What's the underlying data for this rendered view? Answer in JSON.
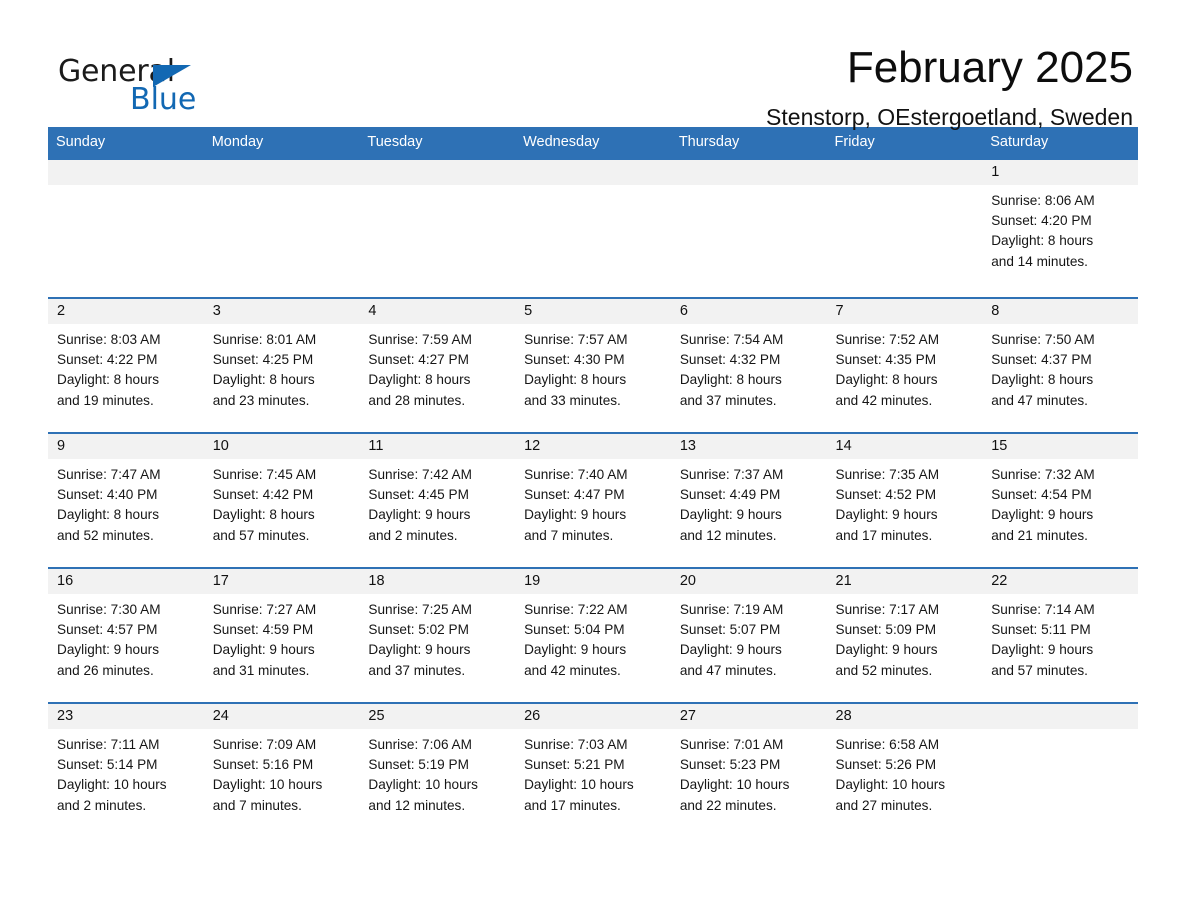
{
  "brand": {
    "name_part1": "General",
    "name_part2": "Blue",
    "accent_color": "#1268b3"
  },
  "header": {
    "month_title": "February 2025",
    "location": "Stenstorp, OEstergoetland, Sweden"
  },
  "theme": {
    "header_blue": "#2E71B5",
    "daynum_band": "#f2f2f2"
  },
  "weekdays": [
    "Sunday",
    "Monday",
    "Tuesday",
    "Wednesday",
    "Thursday",
    "Friday",
    "Saturday"
  ],
  "weeks": [
    [
      {
        "day": "",
        "info": ""
      },
      {
        "day": "",
        "info": ""
      },
      {
        "day": "",
        "info": ""
      },
      {
        "day": "",
        "info": ""
      },
      {
        "day": "",
        "info": ""
      },
      {
        "day": "",
        "info": ""
      },
      {
        "day": "1",
        "info": "Sunrise: 8:06 AM\nSunset: 4:20 PM\nDaylight: 8 hours\nand 14 minutes."
      }
    ],
    [
      {
        "day": "2",
        "info": "Sunrise: 8:03 AM\nSunset: 4:22 PM\nDaylight: 8 hours\nand 19 minutes."
      },
      {
        "day": "3",
        "info": "Sunrise: 8:01 AM\nSunset: 4:25 PM\nDaylight: 8 hours\nand 23 minutes."
      },
      {
        "day": "4",
        "info": "Sunrise: 7:59 AM\nSunset: 4:27 PM\nDaylight: 8 hours\nand 28 minutes."
      },
      {
        "day": "5",
        "info": "Sunrise: 7:57 AM\nSunset: 4:30 PM\nDaylight: 8 hours\nand 33 minutes."
      },
      {
        "day": "6",
        "info": "Sunrise: 7:54 AM\nSunset: 4:32 PM\nDaylight: 8 hours\nand 37 minutes."
      },
      {
        "day": "7",
        "info": "Sunrise: 7:52 AM\nSunset: 4:35 PM\nDaylight: 8 hours\nand 42 minutes."
      },
      {
        "day": "8",
        "info": "Sunrise: 7:50 AM\nSunset: 4:37 PM\nDaylight: 8 hours\nand 47 minutes."
      }
    ],
    [
      {
        "day": "9",
        "info": "Sunrise: 7:47 AM\nSunset: 4:40 PM\nDaylight: 8 hours\nand 52 minutes."
      },
      {
        "day": "10",
        "info": "Sunrise: 7:45 AM\nSunset: 4:42 PM\nDaylight: 8 hours\nand 57 minutes."
      },
      {
        "day": "11",
        "info": "Sunrise: 7:42 AM\nSunset: 4:45 PM\nDaylight: 9 hours\nand 2 minutes."
      },
      {
        "day": "12",
        "info": "Sunrise: 7:40 AM\nSunset: 4:47 PM\nDaylight: 9 hours\nand 7 minutes."
      },
      {
        "day": "13",
        "info": "Sunrise: 7:37 AM\nSunset: 4:49 PM\nDaylight: 9 hours\nand 12 minutes."
      },
      {
        "day": "14",
        "info": "Sunrise: 7:35 AM\nSunset: 4:52 PM\nDaylight: 9 hours\nand 17 minutes."
      },
      {
        "day": "15",
        "info": "Sunrise: 7:32 AM\nSunset: 4:54 PM\nDaylight: 9 hours\nand 21 minutes."
      }
    ],
    [
      {
        "day": "16",
        "info": "Sunrise: 7:30 AM\nSunset: 4:57 PM\nDaylight: 9 hours\nand 26 minutes."
      },
      {
        "day": "17",
        "info": "Sunrise: 7:27 AM\nSunset: 4:59 PM\nDaylight: 9 hours\nand 31 minutes."
      },
      {
        "day": "18",
        "info": "Sunrise: 7:25 AM\nSunset: 5:02 PM\nDaylight: 9 hours\nand 37 minutes."
      },
      {
        "day": "19",
        "info": "Sunrise: 7:22 AM\nSunset: 5:04 PM\nDaylight: 9 hours\nand 42 minutes."
      },
      {
        "day": "20",
        "info": "Sunrise: 7:19 AM\nSunset: 5:07 PM\nDaylight: 9 hours\nand 47 minutes."
      },
      {
        "day": "21",
        "info": "Sunrise: 7:17 AM\nSunset: 5:09 PM\nDaylight: 9 hours\nand 52 minutes."
      },
      {
        "day": "22",
        "info": "Sunrise: 7:14 AM\nSunset: 5:11 PM\nDaylight: 9 hours\nand 57 minutes."
      }
    ],
    [
      {
        "day": "23",
        "info": "Sunrise: 7:11 AM\nSunset: 5:14 PM\nDaylight: 10 hours\nand 2 minutes."
      },
      {
        "day": "24",
        "info": "Sunrise: 7:09 AM\nSunset: 5:16 PM\nDaylight: 10 hours\nand 7 minutes."
      },
      {
        "day": "25",
        "info": "Sunrise: 7:06 AM\nSunset: 5:19 PM\nDaylight: 10 hours\nand 12 minutes."
      },
      {
        "day": "26",
        "info": "Sunrise: 7:03 AM\nSunset: 5:21 PM\nDaylight: 10 hours\nand 17 minutes."
      },
      {
        "day": "27",
        "info": "Sunrise: 7:01 AM\nSunset: 5:23 PM\nDaylight: 10 hours\nand 22 minutes."
      },
      {
        "day": "28",
        "info": "Sunrise: 6:58 AM\nSunset: 5:26 PM\nDaylight: 10 hours\nand 27 minutes."
      },
      {
        "day": "",
        "info": ""
      }
    ]
  ]
}
